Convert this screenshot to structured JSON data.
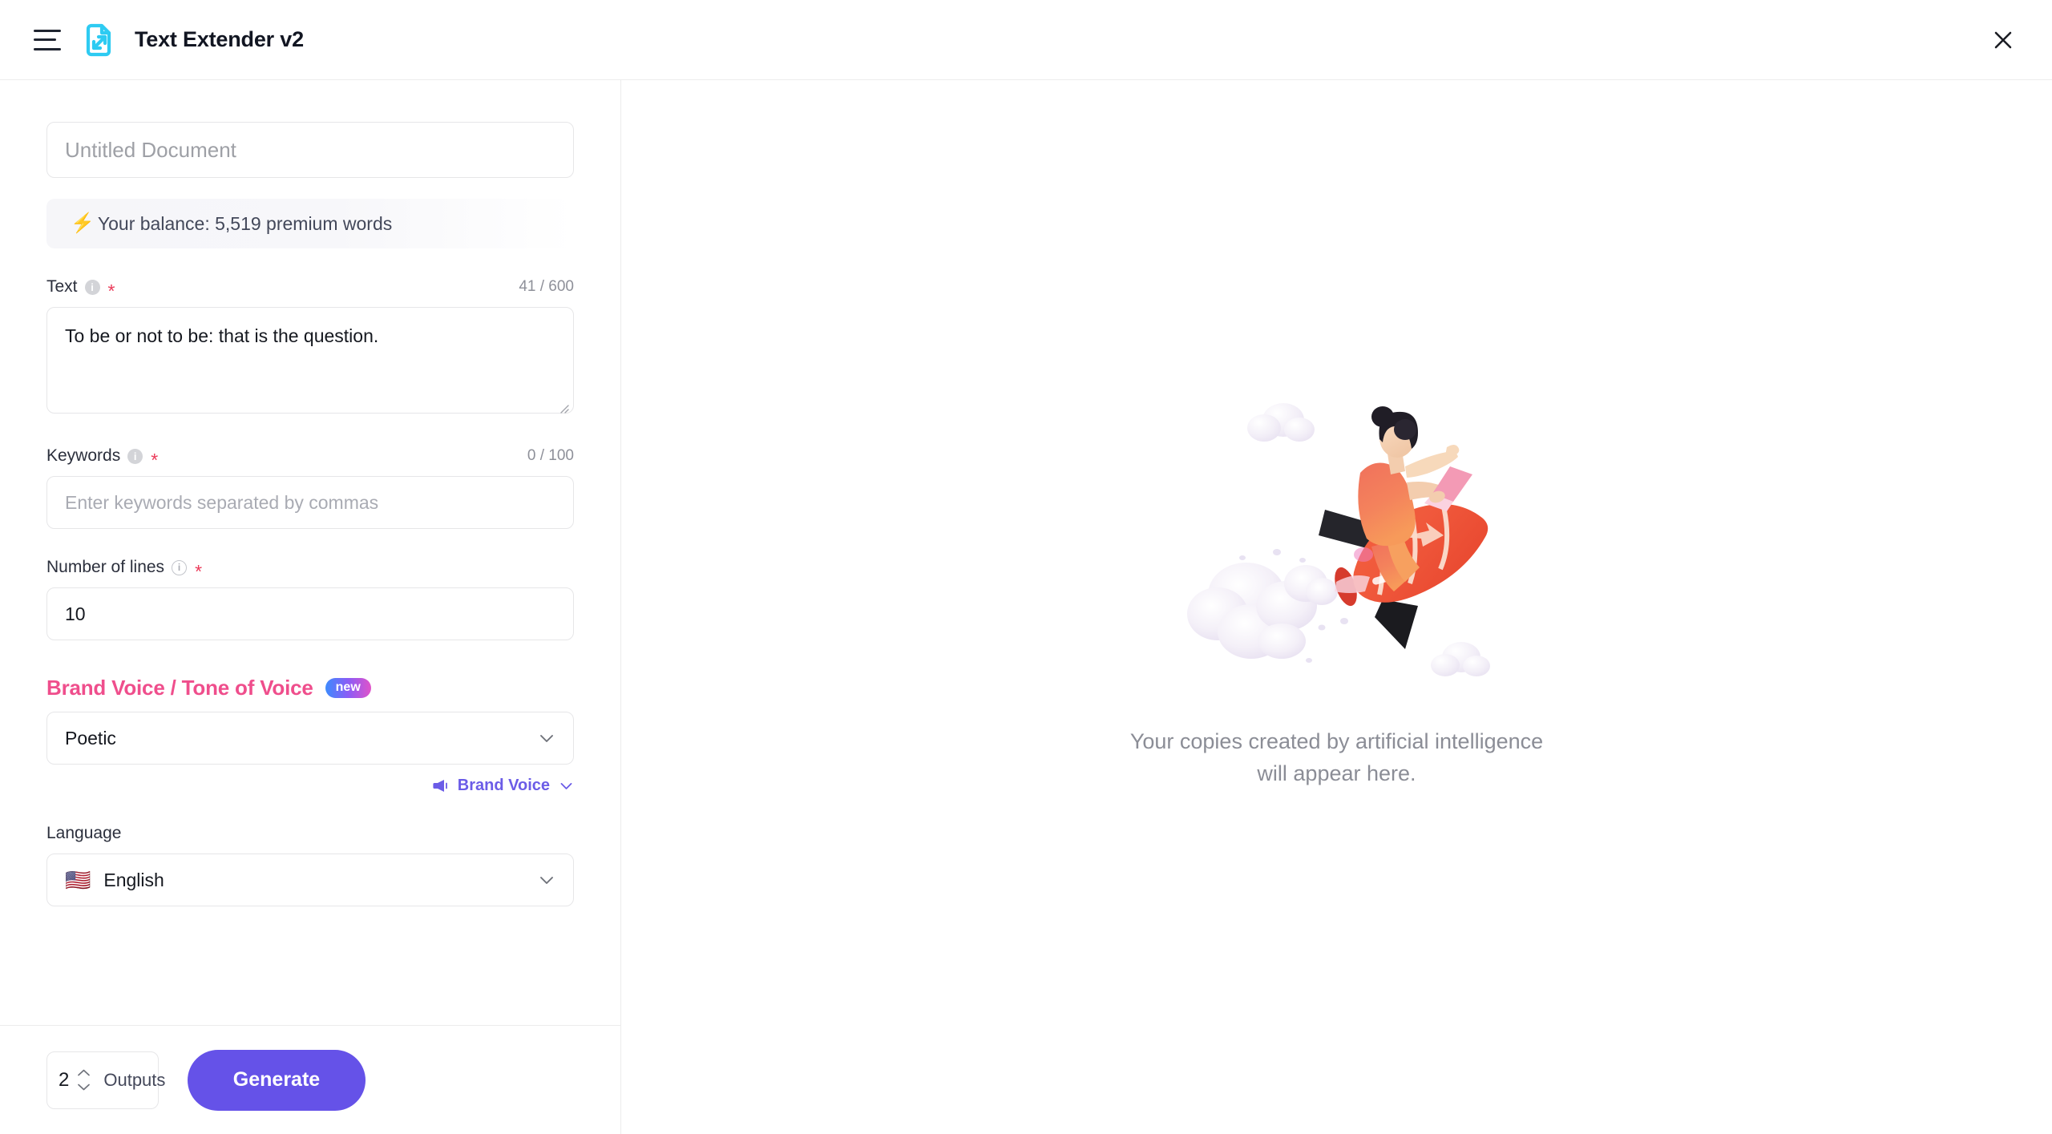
{
  "header": {
    "menu_icon": "hamburger-menu-icon",
    "logo_icon": "text-extender-logo-icon",
    "title": "Text Extender v2",
    "close_icon": "close-icon"
  },
  "left_panel": {
    "doc_title": {
      "value": "",
      "placeholder": "Untitled Document"
    },
    "balance": {
      "icon": "lightning-bolt-icon",
      "text": "Your balance: 5,519 premium words"
    },
    "text_field": {
      "label": "Text",
      "info_icon": "info-circle-icon",
      "required_mark": "*",
      "counter": "41 / 600",
      "value": "To be or not to be: that is the question."
    },
    "keywords_field": {
      "label": "Keywords",
      "info_icon": "info-circle-icon",
      "required_mark": "*",
      "counter": "0 / 100",
      "value": "",
      "placeholder": "Enter keywords separated by commas"
    },
    "lines_field": {
      "label": "Number of lines",
      "info_icon": "info-circle-outline-icon",
      "required_mark": "*",
      "value": "10"
    },
    "brand_voice": {
      "heading": "Brand Voice / Tone of Voice",
      "badge": "new",
      "selected_tone": "Poetic",
      "chevron_icon": "chevron-down-icon",
      "link_label": "Brand Voice",
      "link_icon": "megaphone-icon",
      "link_chevron_icon": "chevron-down-icon"
    },
    "language": {
      "label": "Language",
      "flag": "🇺🇸",
      "selected": "English",
      "chevron_icon": "chevron-down-icon"
    },
    "footer": {
      "outputs_value": "2",
      "outputs_label": "Outputs",
      "up_icon": "chevron-up-icon",
      "down_icon": "chevron-down-icon",
      "generate_label": "Generate"
    }
  },
  "right_panel": {
    "illustration": "rocket-astronaut-illustration",
    "empty_state_line1": "Your copies created by artificial intelligence",
    "empty_state_line2": "will appear here."
  },
  "colors": {
    "accent_purple": "#6552e8",
    "brand_pink": "#ef4e8c",
    "logo_cyan": "#2ecbf2",
    "required_red": "#eb3b5a"
  }
}
